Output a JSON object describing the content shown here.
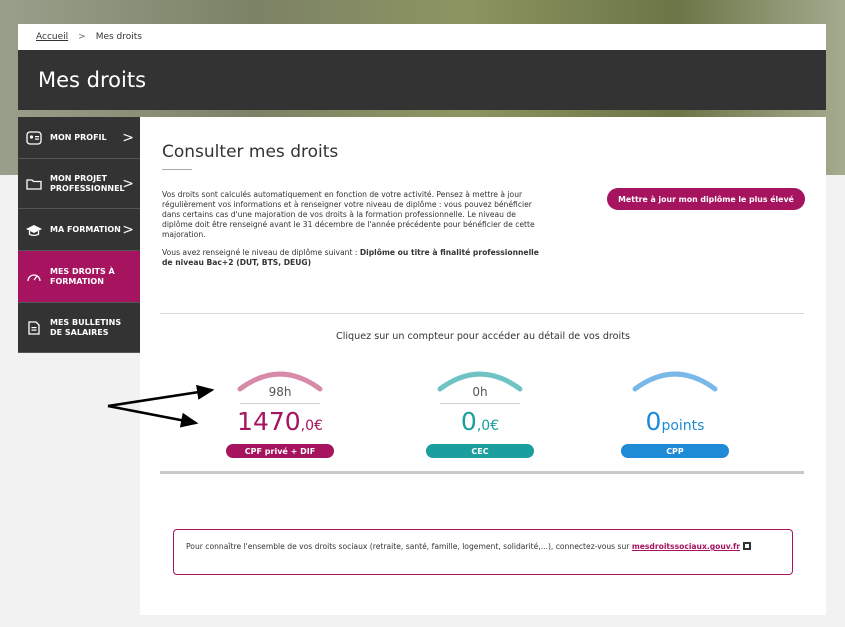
{
  "breadcrumb": {
    "home": "Accueil",
    "separator": ">",
    "current": "Mes droits"
  },
  "page_title": "Mes droits",
  "sidebar": {
    "items": [
      {
        "label": "MON PROFIL",
        "icon": "profile-card-icon",
        "has_chevron": true
      },
      {
        "label": "MON PROJET PROFESSIONNEL",
        "icon": "folder-icon",
        "has_chevron": true
      },
      {
        "label": "MA FORMATION",
        "icon": "graduation-cap-icon",
        "has_chevron": true
      },
      {
        "label": "MES DROITS À FORMATION",
        "icon": "gauge-icon",
        "has_chevron": false,
        "active": true
      },
      {
        "label": "MES BULLETINS DE SALAIRES",
        "icon": "document-icon",
        "has_chevron": false
      }
    ],
    "chevron": ">"
  },
  "main": {
    "title": "Consulter mes droits",
    "intro_p1": "Vos droits sont calculés automatiquement en fonction de votre activité. Pensez à mettre à jour régulièrement vos informations et à renseigner votre niveau de diplôme : vous pouvez bénéficier dans certains cas d'une majoration de vos droits à la formation professionnelle. Le niveau de diplôme doit être renseigné avant le 31 décembre de l'année précédente pour bénéficier de cette majoration.",
    "intro_p2_prefix": "Vous avez renseigné le niveau de diplôme suivant : ",
    "intro_p2_diploma": "Diplôme ou titre à finalité professionnelle de niveau Bac+2 (DUT, BTS, DEUG)",
    "update_button": "Mettre à jour mon diplôme le plus élevé",
    "counters_title": "Cliquez sur un compteur pour accéder au détail de vos droits"
  },
  "counters": [
    {
      "hours": "98h",
      "amount": "1470",
      "unit": ",0€",
      "label": "CPF privé + DIF",
      "color": "#a6135f",
      "arc_color": "#d88aa9"
    },
    {
      "hours": "0h",
      "amount": "0",
      "unit": ",0€",
      "label": "CEC",
      "color": "#1a9e9e",
      "arc_color": "#6fc3c3"
    },
    {
      "hours": "",
      "amount": "0",
      "unit": "points",
      "label": "CPP",
      "color": "#1f8ad6",
      "arc_color": "#7ab8e8"
    }
  ],
  "info_box": {
    "text": "Pour connaître l'ensemble de vos droits sociaux (retraite, santé, famille, logement, solidarité,...), connectez-vous sur ",
    "link": "mesdroitssociaux.gouv.fr"
  },
  "colors": {
    "accent": "#a6135f",
    "dark": "#333333"
  }
}
